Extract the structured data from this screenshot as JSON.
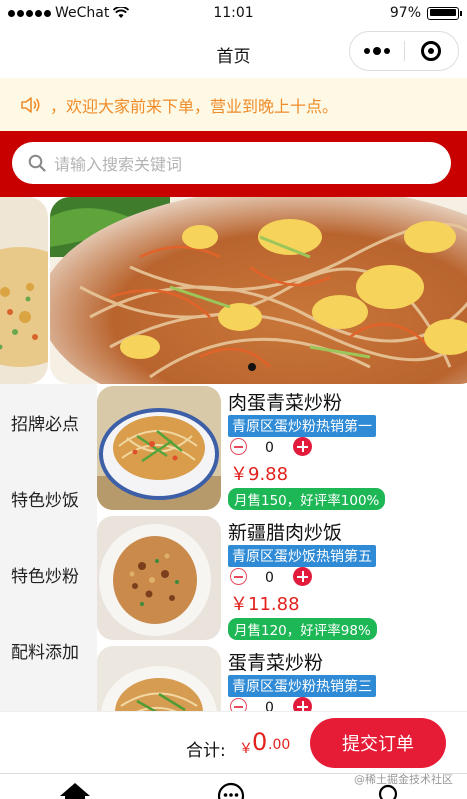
{
  "status_bar": {
    "carrier": "WeChat",
    "time": "11:01",
    "battery": "97%"
  },
  "nav": {
    "title": "首页"
  },
  "notice": {
    "text": "，欢迎大家前来下单，营业到晚上十点。",
    "color": "#ef8c2a"
  },
  "search": {
    "placeholder": "请输入搜索关键词"
  },
  "banner": {
    "active_index": 1
  },
  "categories": [
    {
      "label": "招牌必点"
    },
    {
      "label": "特色炒饭"
    },
    {
      "label": "特色炒粉"
    },
    {
      "label": "配料添加"
    }
  ],
  "products": [
    {
      "name": "肉蛋青菜炒粉",
      "tag": "青原区蛋炒粉热销第一",
      "qty": "0",
      "price": "￥9.88",
      "sales": "月售150，好评率100%"
    },
    {
      "name": "新疆腊肉炒饭",
      "tag": "青原区蛋炒饭热销第五",
      "qty": "0",
      "price": "￥11.88",
      "sales": "月售120，好评率98%"
    },
    {
      "name": "蛋青菜炒粉",
      "tag": "青原区蛋炒粉热销第三",
      "qty": "0",
      "price": "",
      "sales": ""
    }
  ],
  "cart": {
    "total_label": "合计:",
    "currency": "￥",
    "total_int": "0",
    "total_dec": ".00",
    "submit_label": "提交订单"
  },
  "watermark": "@稀土掘金技术社区",
  "colors": {
    "brand_red": "#c90000",
    "price_red": "#e2221c",
    "tag_blue": "#2f8bd6",
    "sales_green": "#1db756"
  }
}
